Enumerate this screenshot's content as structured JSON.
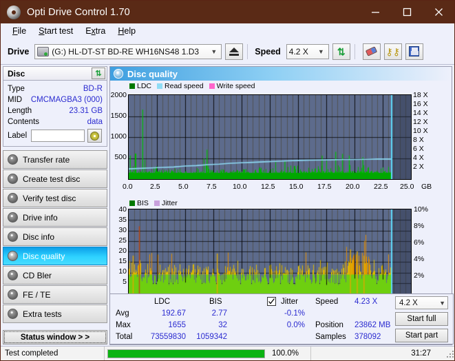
{
  "window": {
    "title": "Opti Drive Control 1.70",
    "icon": "disc-icon",
    "minimize": "minimize-icon",
    "maximize": "maximize-icon",
    "close": "close-icon"
  },
  "menu": {
    "items": [
      {
        "label": "File",
        "accel": "F"
      },
      {
        "label": "Start test",
        "accel": "S"
      },
      {
        "label": "Extra",
        "accel": "x"
      },
      {
        "label": "Help",
        "accel": "H"
      }
    ]
  },
  "toolbar": {
    "drive_label": "Drive",
    "drive_value": "(G:)   HL-DT-ST BD-RE  WH16NS48 1.D3",
    "drive_icon": "drive-icon",
    "eject_icon": "eject-icon",
    "speed_label": "Speed",
    "speed_value": "4.2 X",
    "refresh_icon": "refresh-arrows-icon",
    "erase_icon": "eraser-icon",
    "keys_icon": "keys-icon",
    "save_icon": "floppy-save-icon"
  },
  "disc": {
    "header": "Disc",
    "refresh_icon": "refresh-arrows-icon",
    "rows": [
      {
        "key": "Type",
        "value": "BD-R"
      },
      {
        "key": "MID",
        "value": "CMCMAGBA3 (000)"
      },
      {
        "key": "Length",
        "value": "23.31 GB"
      },
      {
        "key": "Contents",
        "value": "data"
      }
    ],
    "label_key": "Label",
    "label_value": "",
    "label_placeholder": "",
    "cd_icon": "cd-disc-icon"
  },
  "nav": {
    "items": [
      {
        "label": "Transfer rate",
        "active": false
      },
      {
        "label": "Create test disc",
        "active": false
      },
      {
        "label": "Verify test disc",
        "active": false
      },
      {
        "label": "Drive info",
        "active": false
      },
      {
        "label": "Disc info",
        "active": false
      },
      {
        "label": "Disc quality",
        "active": true
      },
      {
        "label": "CD Bler",
        "active": false
      },
      {
        "label": "FE / TE",
        "active": false
      },
      {
        "label": "Extra tests",
        "active": false
      }
    ],
    "status_button": "Status window > >"
  },
  "panel": {
    "title": "Disc quality",
    "icon": "disc-quality-icon"
  },
  "colors": {
    "ldc": "#00a000",
    "read_speed": "#8fdcf5",
    "write_speed": "#ff66cc",
    "bis": "#00a000",
    "jitter": "#c9a0dc",
    "plot_bg": "#5d6b8c",
    "title_bar": "#5a2a16",
    "accent": "#2a2ad0",
    "progress": "#0cb312"
  },
  "chart_data": [
    {
      "type": "area",
      "name": "ldc-chart",
      "title": "",
      "legend": [
        {
          "label": "LDC",
          "color": "#00a000"
        },
        {
          "label": "Read speed",
          "color": "#8fdcf5"
        },
        {
          "label": "Write speed",
          "color": "#ff66cc"
        }
      ],
      "legend_position": "top-left",
      "xlabel": "GB",
      "x_ticks": [
        "0.0",
        "2.5",
        "5.0",
        "7.5",
        "10.0",
        "12.5",
        "15.0",
        "17.5",
        "20.0",
        "22.5",
        "25.0"
      ],
      "xlim": [
        0.0,
        25.0
      ],
      "ylabel_left": "",
      "y_ticks_left": [
        "2000",
        "1500",
        "1000",
        "500"
      ],
      "ylim_left": [
        0,
        2000
      ],
      "ylabel_right": "",
      "y_ticks_right": [
        "18 X",
        "16 X",
        "14 X",
        "12 X",
        "10 X",
        "8 X",
        "6 X",
        "4 X",
        "2 X"
      ],
      "ylim_right": [
        0,
        18
      ],
      "grid": true,
      "data_end_gb": 23.31,
      "series": [
        {
          "name": "LDC",
          "color": "#00a000",
          "type": "spike-area",
          "baseline": 190,
          "x": [
            0.05,
            0.3,
            0.6,
            0.9,
            1.2,
            1.5,
            1.8,
            2.1,
            2.4,
            2.7,
            3.0,
            3.3,
            3.6,
            3.9,
            4.2,
            4.5,
            4.8,
            5.1,
            5.4,
            5.7,
            6.0,
            6.3,
            6.6,
            6.9,
            7.2,
            7.5,
            7.8,
            8.1,
            8.4,
            8.7,
            9.0,
            9.3,
            9.6,
            9.9,
            10.2,
            10.5,
            10.8,
            11.1,
            11.4,
            11.7,
            12.0,
            12.3,
            12.6,
            12.9,
            13.2,
            13.5,
            13.8,
            14.1,
            14.4,
            14.7,
            15.0,
            15.3,
            15.6,
            15.9,
            16.2,
            16.5,
            16.8,
            17.1,
            17.4,
            17.7,
            18.0,
            18.3,
            18.6,
            18.9,
            19.2,
            19.5,
            19.8,
            20.1,
            20.4,
            20.7,
            21.0,
            21.3,
            21.6,
            21.9,
            22.2,
            22.5,
            22.8,
            23.1,
            23.3
          ],
          "y": [
            560,
            300,
            610,
            480,
            1655,
            450,
            620,
            380,
            520,
            300,
            340,
            260,
            240,
            230,
            260,
            410,
            520,
            330,
            290,
            260,
            300,
            280,
            440,
            700,
            320,
            280,
            260,
            290,
            300,
            330,
            280,
            300,
            260,
            280,
            300,
            330,
            420,
            300,
            280,
            310,
            330,
            300,
            350,
            480,
            330,
            300,
            420,
            330,
            310,
            360,
            330,
            300,
            330,
            380,
            350,
            330,
            380,
            560,
            430,
            380,
            600,
            650,
            520,
            600,
            420,
            560,
            400,
            430,
            380,
            520,
            400,
            360,
            400,
            430,
            380,
            420,
            400,
            370,
            350
          ]
        },
        {
          "name": "Read speed",
          "color": "#8fdcf5",
          "type": "line",
          "x": [
            0.0,
            1.0,
            2.0,
            3.0,
            4.0,
            5.0,
            6.0,
            7.0,
            8.0,
            9.0,
            10.0,
            11.0,
            12.0,
            13.0,
            14.0,
            15.0,
            16.0,
            17.0,
            18.0,
            19.0,
            20.0,
            21.0,
            22.0,
            23.0,
            23.3
          ],
          "y": [
            2.2,
            2.3,
            2.4,
            2.5,
            2.6,
            2.8,
            2.9,
            3.1,
            3.2,
            3.4,
            3.5,
            3.6,
            3.7,
            3.8,
            3.9,
            4.0,
            4.05,
            4.1,
            4.15,
            4.2,
            4.2,
            4.25,
            4.3,
            4.3,
            4.3
          ]
        },
        {
          "name": "Write speed",
          "color": "#ff66cc",
          "type": "line",
          "x": [],
          "y": []
        }
      ]
    },
    {
      "type": "bar",
      "name": "bis-chart",
      "title": "",
      "legend": [
        {
          "label": "BIS",
          "color": "#00a000"
        },
        {
          "label": "Jitter",
          "color": "#c9a0dc"
        }
      ],
      "legend_position": "top-left",
      "xlabel": "GB",
      "x_ticks": [
        "0.0",
        "2.5",
        "5.0",
        "7.5",
        "10.0",
        "12.5",
        "15.0",
        "17.5",
        "20.0",
        "22.5",
        "25.0"
      ],
      "xlim": [
        0.0,
        25.0
      ],
      "y_ticks_left": [
        "40",
        "35",
        "30",
        "25",
        "20",
        "15",
        "10",
        "5"
      ],
      "ylim_left": [
        0,
        40
      ],
      "y_ticks_right": [
        "10%",
        "8%",
        "6%",
        "4%",
        "2%"
      ],
      "ylim_right": [
        0,
        10
      ],
      "grid": true,
      "data_end_gb": 23.31,
      "series": [
        {
          "name": "BIS",
          "color": "#7fd21a",
          "peak_color": "#e0a800",
          "type": "dense-bars",
          "avg": 2.77,
          "max": 32,
          "typical_range": [
            4,
            14
          ],
          "peaks": [
            {
              "x": 0.35,
              "y": 18
            },
            {
              "x": 0.9,
              "y": 32
            },
            {
              "x": 7.8,
              "y": 19
            },
            {
              "x": 19.6,
              "y": 21
            },
            {
              "x": 20.2,
              "y": 20
            },
            {
              "x": 20.8,
              "y": 18
            }
          ]
        }
      ]
    }
  ],
  "stats": {
    "col_ldc": "LDC",
    "col_bis": "BIS",
    "jitter_label": "Jitter",
    "jitter_checked": true,
    "rows": [
      {
        "label": "Avg",
        "ldc": "192.67",
        "bis": "2.77",
        "jitter": "-0.1%"
      },
      {
        "label": "Max",
        "ldc": "1655",
        "bis": "32",
        "jitter": "0.0%"
      },
      {
        "label": "Total",
        "ldc": "73559830",
        "bis": "1059342",
        "jitter": ""
      }
    ],
    "speed_label": "Speed",
    "speed_value": "4.23 X",
    "position_label": "Position",
    "position_value": "23862 MB",
    "samples_label": "Samples",
    "samples_value": "378092",
    "speed_select": "4.2 X",
    "start_full": "Start full",
    "start_part": "Start part"
  },
  "statusbar": {
    "message": "Test completed",
    "progress_percent": "100.0%",
    "progress_value": 100,
    "elapsed": "31:27"
  }
}
